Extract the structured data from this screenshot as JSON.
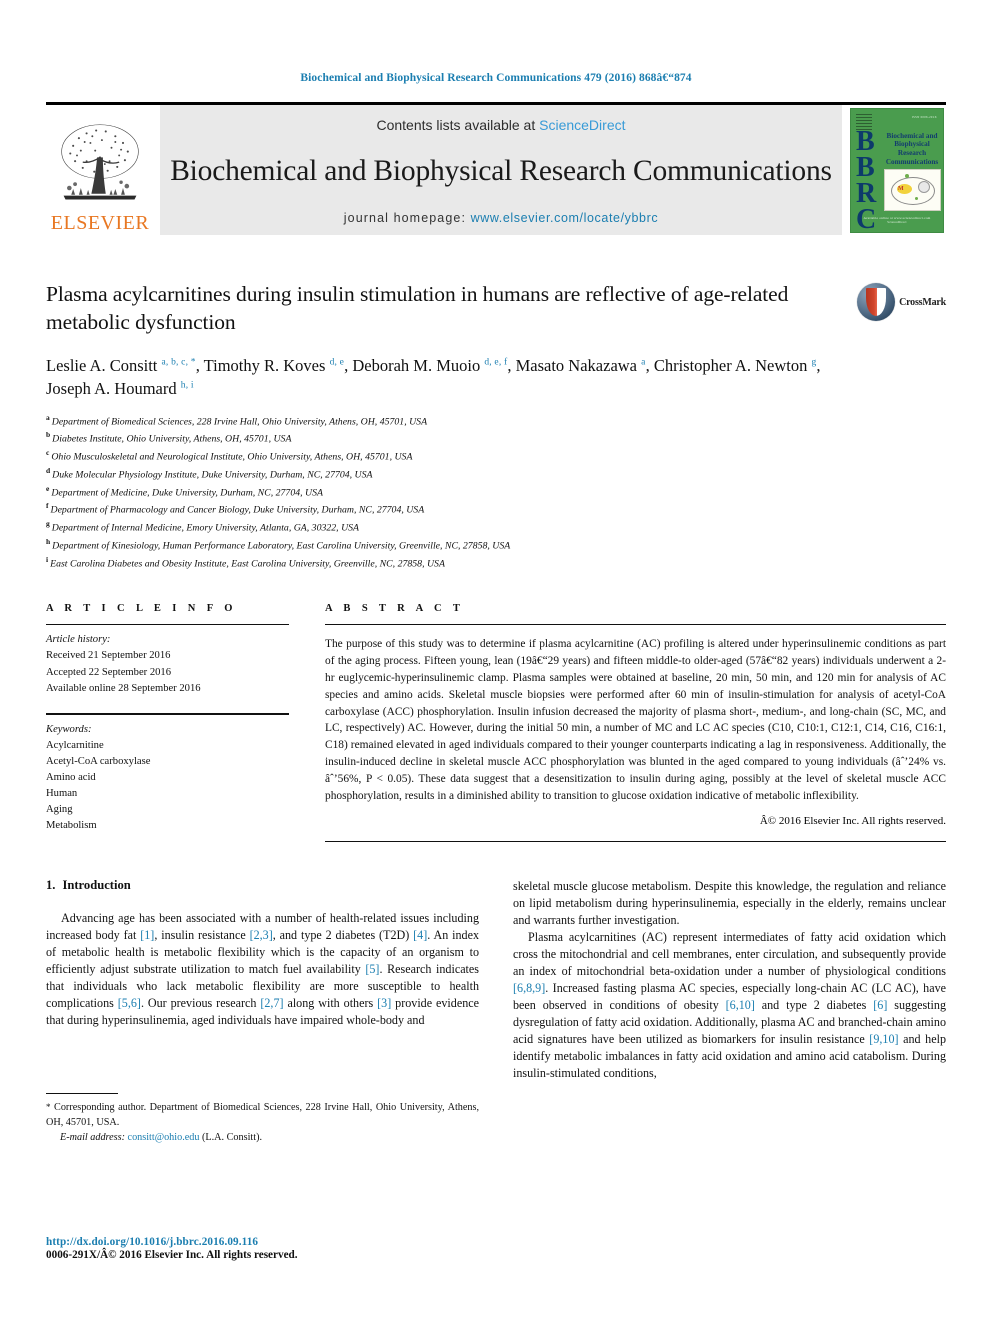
{
  "running_head": "Biochemical and Biophysical Research Communications 479 (2016) 868â€“874",
  "masthead": {
    "publisher_name": "ELSEVIER",
    "contents_prefix": "Contents lists available at ",
    "contents_link": "ScienceDirect",
    "journal_title": "Biochemical and Biophysical Research Communications",
    "homepage_label": "journal homepage: ",
    "homepage_url": "www.elsevier.com/locate/ybbrc",
    "cover": {
      "letters": "BBRC",
      "journal_name": "Biochemical and Biophysical Research Communications",
      "bottom_line_1": "Available online at www.sciencedirect.com",
      "bottom_line_2": "ScienceDirect",
      "color": "#4a9c4e"
    }
  },
  "article": {
    "title": "Plasma acylcarnitines during insulin stimulation in humans are reflective of age-related metabolic dysfunction",
    "crossmark_label": "CrossMark",
    "authors_html": "Leslie A. Consitt <sup>a, b, c, *</sup>, Timothy R. Koves <sup>d, e</sup>, Deborah M. Muoio <sup>d, e, f</sup>, Masato Nakazawa <sup>a</sup>, Christopher A. Newton <sup>g</sup>, Joseph A. Houmard <sup>h, i</sup>",
    "affiliations": [
      {
        "mark": "a",
        "text": "Department of Biomedical Sciences, 228 Irvine Hall, Ohio University, Athens, OH, 45701, USA"
      },
      {
        "mark": "b",
        "text": "Diabetes Institute, Ohio University, Athens, OH, 45701, USA"
      },
      {
        "mark": "c",
        "text": "Ohio Musculoskeletal and Neurological Institute, Ohio University, Athens, OH, 45701, USA"
      },
      {
        "mark": "d",
        "text": "Duke Molecular Physiology Institute, Duke University, Durham, NC, 27704, USA"
      },
      {
        "mark": "e",
        "text": "Department of Medicine, Duke University, Durham, NC, 27704, USA"
      },
      {
        "mark": "f",
        "text": "Department of Pharmacology and Cancer Biology, Duke University, Durham, NC, 27704, USA"
      },
      {
        "mark": "g",
        "text": "Department of Internal Medicine, Emory University, Atlanta, GA, 30322, USA"
      },
      {
        "mark": "h",
        "text": "Department of Kinesiology, Human Performance Laboratory, East Carolina University, Greenville, NC, 27858, USA"
      },
      {
        "mark": "i",
        "text": "East Carolina Diabetes and Obesity Institute, East Carolina University, Greenville, NC, 27858, USA"
      }
    ]
  },
  "article_info": {
    "heading": "A R T I C L E   I N F O",
    "history_label": "Article history:",
    "history": [
      "Received 21 September 2016",
      "Accepted 22 September 2016",
      "Available online 28 September 2016"
    ],
    "keywords_label": "Keywords:",
    "keywords": [
      "Acylcarnitine",
      "Acetyl-CoA carboxylase",
      "Amino acid",
      "Human",
      "Aging",
      "Metabolism"
    ]
  },
  "abstract": {
    "heading": "A B S T R A C T",
    "text": "The purpose of this study was to determine if plasma acylcarnitine (AC) profiling is altered under hyperinsulinemic conditions as part of the aging process. Fifteen young, lean (19â€“29 years) and fifteen middle-to older-aged (57â€“82 years) individuals underwent a 2-hr euglycemic-hyperinsulinemic clamp. Plasma samples were obtained at baseline, 20 min, 50 min, and 120 min for analysis of AC species and amino acids. Skeletal muscle biopsies were performed after 60 min of insulin-stimulation for analysis of acetyl-CoA carboxylase (ACC) phosphorylation. Insulin infusion decreased the majority of plasma short-, medium-, and long-chain (SC, MC, and LC, respectively) AC. However, during the initial 50 min, a number of MC and LC AC species (C10, C10:1, C12:1, C14, C16, C16:1, C18) remained elevated in aged individuals compared to their younger counterparts indicating a lag in responsiveness. Additionally, the insulin-induced decline in skeletal muscle ACC phosphorylation was blunted in the aged compared to young individuals (âˆ’24% vs. âˆ’56%, P < 0.05). These data suggest that a desensitization to insulin during aging, possibly at the level of skeletal muscle ACC phosphorylation, results in a diminished ability to transition to glucose oxidation indicative of metabolic inflexibility.",
    "copyright": "Â© 2016 Elsevier Inc. All rights reserved."
  },
  "body": {
    "section_number": "1.",
    "section_title": "Introduction",
    "left_paragraph_1_html": "Advancing age has been associated with a number of health-related issues including increased body fat <span class=\"ref\">[1]</span>, insulin resistance <span class=\"ref\">[2,3]</span>, and type 2 diabetes (T2D) <span class=\"ref\">[4]</span>. An index of metabolic health is metabolic flexibility which is the capacity of an organism to efficiently adjust substrate utilization to match fuel availability <span class=\"ref\">[5]</span>. Research indicates that individuals who lack metabolic flexibility are more susceptible to health complications <span class=\"ref\">[5,6]</span>. Our previous research <span class=\"ref\">[2,7]</span> along with others <span class=\"ref\">[3]</span> provide evidence that during hyperinsulinemia, aged individuals have impaired whole-body and",
    "right_paragraph_1_html": "skeletal muscle glucose metabolism. Despite this knowledge, the regulation and reliance on lipid metabolism during hyperinsulinemia, especially in the elderly, remains unclear and warrants further investigation.",
    "right_paragraph_2_html": "Plasma acylcarnitines (AC) represent intermediates of fatty acid oxidation which cross the mitochondrial and cell membranes, enter circulation, and subsequently provide an index of mitochondrial beta-oxidation under a number of physiological conditions <span class=\"ref\">[6,8,9]</span>. Increased fasting plasma AC species, especially long-chain AC (LC AC), have been observed in conditions of obesity <span class=\"ref\">[6,10]</span> and type 2 diabetes <span class=\"ref\">[6]</span> suggesting dysregulation of fatty acid oxidation. Additionally, plasma AC and branched-chain amino acid signatures have been utilized as biomarkers for insulin resistance <span class=\"ref\">[9,10]</span> and help identify metabolic imbalances in fatty acid oxidation and amino acid catabolism. During insulin-stimulated conditions,"
  },
  "footnote": {
    "corresponding_html": "<span class=\"star\">*</span> Corresponding author. Department of Biomedical Sciences, 228 Irvine Hall, Ohio University, Athens, OH, 45701, USA.",
    "email_label": "E-mail address:",
    "email": "consitt@ohio.edu",
    "email_suffix": "(L.A. Consitt)."
  },
  "page_footer": {
    "doi": "http://dx.doi.org/10.1016/j.bbrc.2016.09.116",
    "issn_line": "0006-291X/Â© 2016 Elsevier Inc. All rights reserved."
  },
  "colors": {
    "link_blue": "#1b7eb0",
    "sciencedirect_blue": "#389bd7",
    "elsevier_orange": "#e87722",
    "cover_green": "#4a9c4e"
  }
}
